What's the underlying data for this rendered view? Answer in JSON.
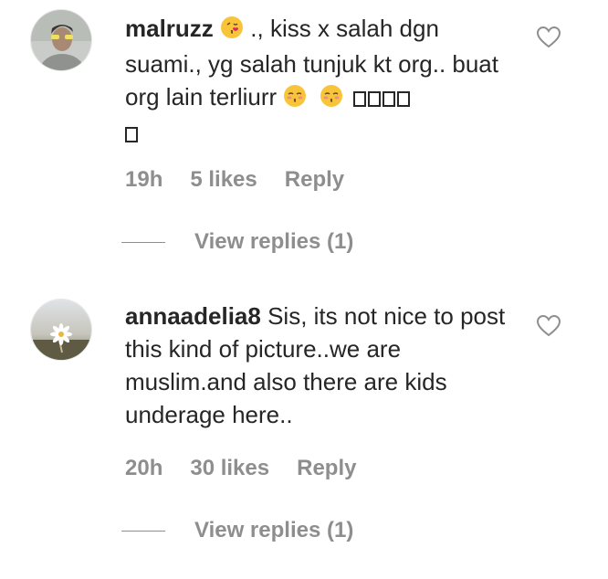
{
  "comments": [
    {
      "username": "malruzz",
      "text_segment_1": " ., kiss x salah dgn suami., yg salah tunjuk kt org.. buat org lain terliurr",
      "emoji_1": "kiss-face-emoji",
      "emoji_2": "kissing-closed-eyes-emoji",
      "emoji_3": "kissing-closed-eyes-emoji",
      "unrendered_boxes": 5,
      "time": "19h",
      "likes": "5 likes",
      "reply_label": "Reply",
      "view_replies": "View replies (1)",
      "heart_icon": "heart-outline-icon"
    },
    {
      "username": "annaadelia8",
      "text": " Sis, its not nice to post this kind of picture..we are muslim.and also there are kids underage here..",
      "time": "20h",
      "likes": "30 likes",
      "reply_label": "Reply",
      "view_replies": "View replies (1)",
      "heart_icon": "heart-outline-icon"
    }
  ],
  "colors": {
    "primary_text": "#262626",
    "secondary_text": "#8e8e8e",
    "background": "#ffffff"
  }
}
